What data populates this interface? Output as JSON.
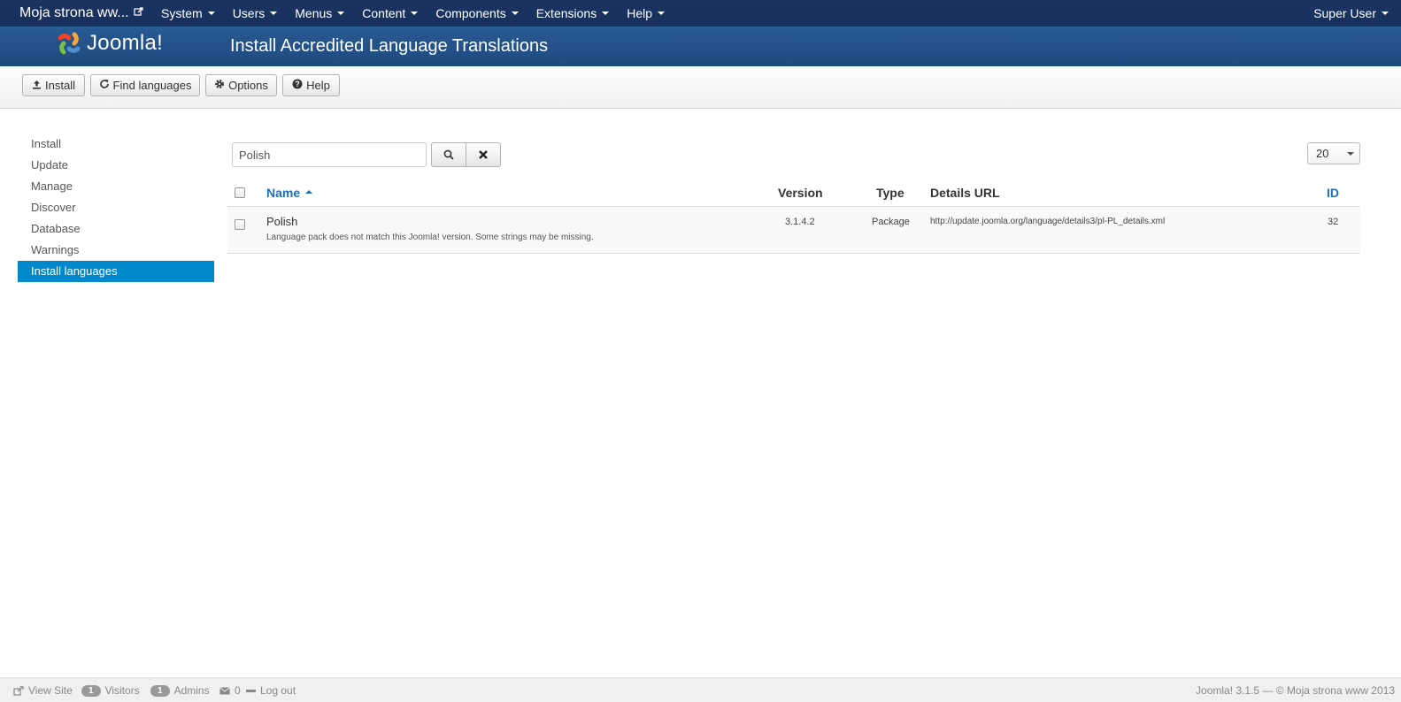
{
  "navbar": {
    "site_name": "Moja strona ww...",
    "menu": [
      "System",
      "Users",
      "Menus",
      "Content",
      "Components",
      "Extensions",
      "Help"
    ],
    "user": "Super User"
  },
  "header": {
    "logo_text": "Joomla!",
    "title": "Install Accredited Language Translations"
  },
  "toolbar": {
    "install": "Install",
    "find_languages": "Find languages",
    "options": "Options",
    "help": "Help"
  },
  "sidebar": {
    "items": [
      "Install",
      "Update",
      "Manage",
      "Discover",
      "Database",
      "Warnings",
      "Install languages"
    ],
    "active_index": 6
  },
  "filter": {
    "search_value": "Polish",
    "list_limit": "20"
  },
  "table": {
    "headers": {
      "name": "Name",
      "version": "Version",
      "type": "Type",
      "details_url": "Details URL",
      "id": "ID"
    },
    "rows": [
      {
        "name": "Polish",
        "note": "Language pack does not match this Joomla! version. Some strings may be missing.",
        "version": "3.1.4.2",
        "type": "Package",
        "details_url": "http://update.joomla.org/language/details3/pl-PL_details.xml",
        "id": "32"
      }
    ]
  },
  "footer": {
    "view_site": "View Site",
    "visitors_count": "1",
    "visitors_label": "Visitors",
    "admins_count": "1",
    "admins_label": "Admins",
    "messages_count": "0",
    "logout": "Log out",
    "copyright": "Joomla! 3.1.5 — © Moja strona www 2013"
  },
  "colors": {
    "navbar": "#17305c",
    "header": "#1d4a7f",
    "active": "#0088cc",
    "link": "#1c6fb4"
  }
}
